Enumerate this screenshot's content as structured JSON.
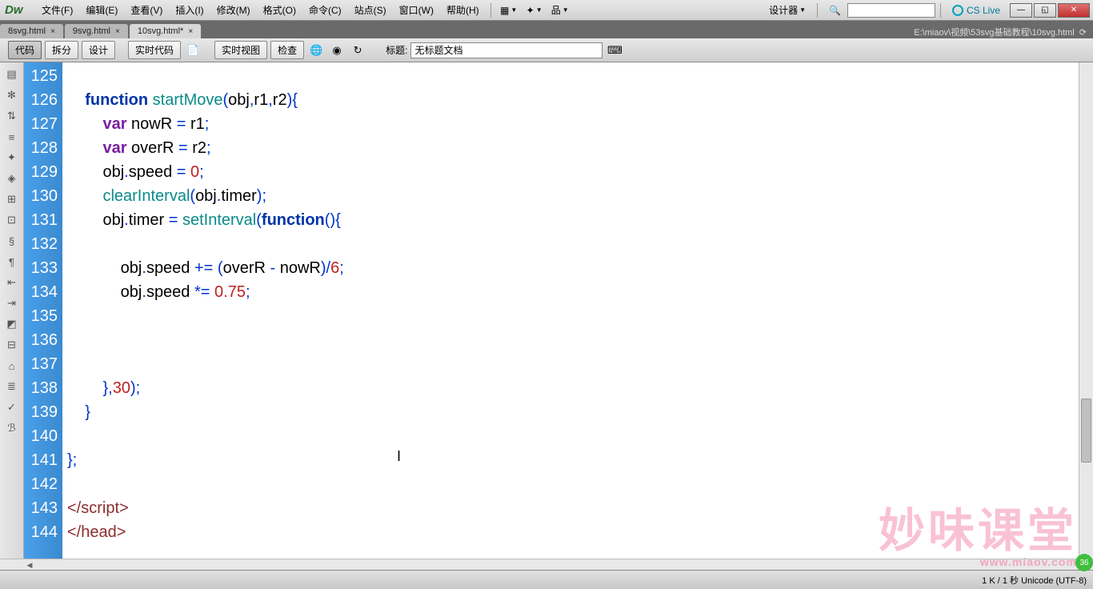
{
  "menu": {
    "items": [
      "文件(F)",
      "编辑(E)",
      "查看(V)",
      "插入(I)",
      "修改(M)",
      "格式(O)",
      "命令(C)",
      "站点(S)",
      "窗口(W)",
      "帮助(H)"
    ],
    "designer": "设计器",
    "cslive": "CS Live"
  },
  "tabs": {
    "items": [
      {
        "label": "8svg.html",
        "active": false
      },
      {
        "label": "9svg.html",
        "active": false
      },
      {
        "label": "10svg.html*",
        "active": true
      }
    ],
    "path": "E:\\miaov\\视频\\53svg基础教程\\10svg.html"
  },
  "toolbar": {
    "code": "代码",
    "split": "拆分",
    "design": "设计",
    "livecode": "实时代码",
    "liveview": "实时视图",
    "inspect": "检查",
    "title_label": "标题:",
    "title_value": "无标题文档"
  },
  "gutter": {
    "start": 125,
    "end": 144
  },
  "code_lines": [
    {
      "n": 125,
      "html": ""
    },
    {
      "n": 126,
      "html": "    <span class='kw'>function</span> <span class='fn'>startMove</span><span class='op'>(</span>obj<span class='op'>,</span>r1<span class='op'>,</span>r2<span class='op'>){</span>"
    },
    {
      "n": 127,
      "html": "        <span class='var'>var</span> nowR <span class='op'>=</span> r1<span class='op'>;</span>"
    },
    {
      "n": 128,
      "html": "        <span class='var'>var</span> overR <span class='op'>=</span> r2<span class='op'>;</span>"
    },
    {
      "n": 129,
      "html": "        obj<span class='op'>.</span>speed <span class='op'>=</span> <span class='num'>0</span><span class='op'>;</span>"
    },
    {
      "n": 130,
      "html": "        <span class='fn'>clearInterval</span><span class='op'>(</span>obj<span class='op'>.</span>timer<span class='op'>);</span>"
    },
    {
      "n": 131,
      "html": "        obj<span class='op'>.</span>timer <span class='op'>=</span> <span class='fn'>setInterval</span><span class='op'>(</span><span class='kw'>function</span><span class='op'>(){</span>"
    },
    {
      "n": 132,
      "html": ""
    },
    {
      "n": 133,
      "html": "            obj<span class='op'>.</span>speed <span class='op'>+=</span> <span class='op'>(</span>overR <span class='op'>-</span> nowR<span class='op'>)/</span><span class='num'>6</span><span class='op'>;</span>"
    },
    {
      "n": 134,
      "html": "            obj<span class='op'>.</span>speed <span class='op'>*=</span> <span class='num'>0.75</span><span class='op'>;</span>"
    },
    {
      "n": 135,
      "html": ""
    },
    {
      "n": 136,
      "html": ""
    },
    {
      "n": 137,
      "html": ""
    },
    {
      "n": 138,
      "html": "        <span class='op'>},</span><span class='num'>30</span><span class='op'>);</span>"
    },
    {
      "n": 139,
      "html": "    <span class='op'>}</span>"
    },
    {
      "n": 140,
      "html": ""
    },
    {
      "n": 141,
      "html": "<span class='op'>};</span>"
    },
    {
      "n": 142,
      "html": ""
    },
    {
      "n": 143,
      "html": "<span class='tag'>&lt;/script&gt;</span>"
    },
    {
      "n": 144,
      "html": "<span class='tag'>&lt;/head&gt;</span>"
    }
  ],
  "status": {
    "info": "1 K / 1 秒 Unicode (UTF-8)"
  },
  "watermark": {
    "text": "妙味课堂",
    "url": "www.miaov.com"
  },
  "badge": "36"
}
